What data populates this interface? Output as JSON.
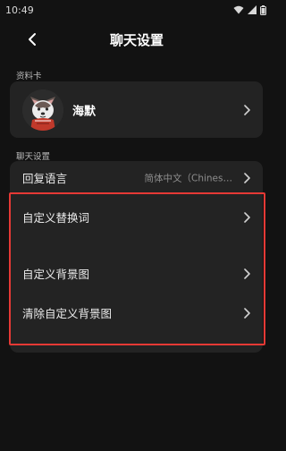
{
  "status_bar": {
    "time": "10:49",
    "icons": [
      "wifi-icon",
      "signal-icon",
      "battery-icon"
    ]
  },
  "header": {
    "back_icon": "chevron-left-icon",
    "title": "聊天设置"
  },
  "profile_section": {
    "label": "资料卡",
    "name": "海默",
    "avatar_icon": "husky-avatar"
  },
  "chat_section": {
    "label": "聊天设置",
    "reply_language": {
      "label": "回复语言",
      "value": "简体中文（Chines…"
    },
    "custom_replace_words": {
      "label": "自定义替换词"
    },
    "custom_background": {
      "label": "自定义背景图"
    },
    "clear_custom_background": {
      "label": "清除自定义背景图"
    }
  },
  "colors": {
    "background": "#121212",
    "card": "#232323",
    "highlight": "#e53935",
    "text_secondary": "#8e8e8e"
  }
}
